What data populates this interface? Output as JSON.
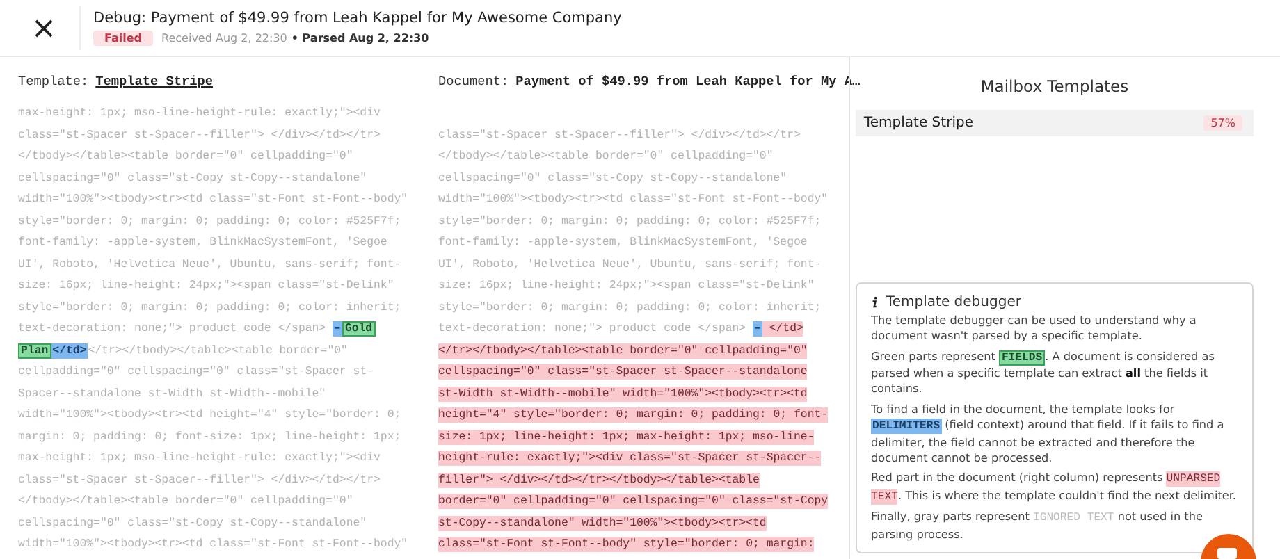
{
  "header": {
    "title": "Debug: Payment of $49.99 from Leah Kappel for My Awesome Company",
    "status": {
      "kind": "failed",
      "label": "Failed"
    },
    "received": "Received Aug 2, 22:30",
    "parsed": "• Parsed Aug 2, 22:30"
  },
  "template_pane": {
    "label": "Template:",
    "name": "Template Stripe",
    "lines": [
      [
        {
          "kind": "ignored",
          "text": "max-height: 1px; mso-line-height-rule: exactly;\"><div"
        }
      ],
      [
        {
          "kind": "ignored",
          "text": "class=\"st-Spacer st-Spacer--filler\"> </div></td></tr>"
        }
      ],
      [
        {
          "kind": "ignored",
          "text": "</tbody></table><table border=\"0\" cellpadding=\"0\""
        }
      ],
      [
        {
          "kind": "ignored",
          "text": "cellspacing=\"0\" class=\"st-Copy st-Copy--standalone\""
        }
      ],
      [
        {
          "kind": "ignored",
          "text": "width=\"100%\"><tbody><tr><td class=\"st-Font st-Font--body\""
        }
      ],
      [
        {
          "kind": "ignored",
          "text": "style=\"border: 0; margin: 0; padding: 0; color: #525F7f;"
        }
      ],
      [
        {
          "kind": "ignored",
          "text": "font-family: -apple-system, BlinkMacSystemFont, 'Segoe"
        }
      ],
      [
        {
          "kind": "ignored",
          "text": "UI', Roboto, 'Helvetica Neue', Ubuntu, sans-serif; font-"
        }
      ],
      [
        {
          "kind": "ignored",
          "text": "size: 16px; line-height: 24px;\"><span class=\"st-Delink\""
        }
      ],
      [
        {
          "kind": "ignored",
          "text": "style=\"border: 0; margin: 0; padding: 0; color: inherit;"
        }
      ],
      [
        {
          "kind": "ignored",
          "text": "text-decoration: none;\"> product_code </span> "
        },
        {
          "kind": "delimiter",
          "text": "–"
        },
        {
          "kind": "field",
          "text": "Gold"
        }
      ],
      [
        {
          "kind": "field",
          "text": "Plan"
        },
        {
          "kind": "delimiter",
          "text": "</td>"
        },
        {
          "kind": "ignored",
          "text": "</tr></tbody></table><table border=\"0\""
        }
      ],
      [
        {
          "kind": "ignored",
          "text": "cellpadding=\"0\" cellspacing=\"0\" class=\"st-Spacer st-"
        }
      ],
      [
        {
          "kind": "ignored",
          "text": "Spacer--standalone st-Width st-Width--mobile\""
        }
      ],
      [
        {
          "kind": "ignored",
          "text": "width=\"100%\"><tbody><tr><td height=\"4\" style=\"border: 0;"
        }
      ],
      [
        {
          "kind": "ignored",
          "text": "margin: 0; padding: 0; font-size: 1px; line-height: 1px;"
        }
      ],
      [
        {
          "kind": "ignored",
          "text": "max-height: 1px; mso-line-height-rule: exactly;\"><div"
        }
      ],
      [
        {
          "kind": "ignored",
          "text": "class=\"st-Spacer st-Spacer--filler\"> </div></td></tr>"
        }
      ],
      [
        {
          "kind": "ignored",
          "text": "</tbody></table><table border=\"0\" cellpadding=\"0\""
        }
      ],
      [
        {
          "kind": "ignored",
          "text": "cellspacing=\"0\" class=\"st-Copy st-Copy--standalone\""
        }
      ],
      [
        {
          "kind": "ignored",
          "text": "width=\"100%\"><tbody><tr><td class=\"st-Font st-Font--body\""
        }
      ]
    ]
  },
  "document_pane": {
    "label": "Document:",
    "name": "Payment of $49.99 from Leah Kappel for My A…",
    "lines": [
      [
        {
          "kind": "ignored",
          "text": "class=\"st-Spacer st-Spacer--filler\"> </div></td></tr>"
        }
      ],
      [
        {
          "kind": "ignored",
          "text": "</tbody></table><table border=\"0\" cellpadding=\"0\""
        }
      ],
      [
        {
          "kind": "ignored",
          "text": "cellspacing=\"0\" class=\"st-Copy st-Copy--standalone\""
        }
      ],
      [
        {
          "kind": "ignored",
          "text": "width=\"100%\"><tbody><tr><td class=\"st-Font st-Font--body\""
        }
      ],
      [
        {
          "kind": "ignored",
          "text": "style=\"border: 0; margin: 0; padding: 0; color: #525F7f;"
        }
      ],
      [
        {
          "kind": "ignored",
          "text": "font-family: -apple-system, BlinkMacSystemFont, 'Segoe"
        }
      ],
      [
        {
          "kind": "ignored",
          "text": "UI', Roboto, 'Helvetica Neue', Ubuntu, sans-serif; font-"
        }
      ],
      [
        {
          "kind": "ignored",
          "text": "size: 16px; line-height: 24px;\"><span class=\"st-Delink\""
        }
      ],
      [
        {
          "kind": "ignored",
          "text": "style=\"border: 0; margin: 0; padding: 0; color: inherit;"
        }
      ],
      [
        {
          "kind": "ignored",
          "text": "text-decoration: none;\"> product_code </span> "
        },
        {
          "kind": "delimiter",
          "text": "–"
        },
        {
          "kind": "unparsed",
          "text": " </td>"
        }
      ],
      [
        {
          "kind": "unparsed",
          "text": "</tr></tbody></table><table border=\"0\" cellpadding=\"0\""
        }
      ],
      [
        {
          "kind": "unparsed",
          "text": "cellspacing=\"0\" class=\"st-Spacer st-Spacer--standalone"
        }
      ],
      [
        {
          "kind": "unparsed",
          "text": "st-Width st-Width--mobile\" width=\"100%\"><tbody><tr><td"
        }
      ],
      [
        {
          "kind": "unparsed",
          "text": "height=\"4\" style=\"border: 0; margin: 0; padding: 0; font-"
        }
      ],
      [
        {
          "kind": "unparsed",
          "text": "size: 1px; line-height: 1px; max-height: 1px; mso-line-"
        }
      ],
      [
        {
          "kind": "unparsed",
          "text": "height-rule: exactly;\"><div class=\"st-Spacer st-Spacer--"
        }
      ],
      [
        {
          "kind": "unparsed",
          "text": "filler\"> </div></td></tr></tbody></table><table"
        }
      ],
      [
        {
          "kind": "unparsed",
          "text": "border=\"0\" cellpadding=\"0\" cellspacing=\"0\" class=\"st-Copy"
        }
      ],
      [
        {
          "kind": "unparsed",
          "text": "st-Copy--standalone\" width=\"100%\"><tbody><tr><td"
        }
      ],
      [
        {
          "kind": "unparsed",
          "text": "class=\"st-Font st-Font--body\" style=\"border: 0; margin:"
        }
      ]
    ]
  },
  "mailbox_templates": {
    "title": "Mailbox Templates",
    "items": [
      {
        "name": "Template Stripe",
        "match": "57%",
        "selected": true
      }
    ]
  },
  "debugger": {
    "title": "Template debugger",
    "paragraphs": [
      [
        {
          "kind": "text",
          "text": "The template debugger can be used to understand why a document wasn't parsed by a specific template."
        }
      ],
      [
        {
          "kind": "text",
          "text": "Green parts represent "
        },
        {
          "kind": "field",
          "text": "FIELDS"
        },
        {
          "kind": "text",
          "text": ". A document is considered as parsed when a specific template can extract "
        },
        {
          "kind": "bold",
          "text": "all"
        },
        {
          "kind": "text",
          "text": " the fields it contains."
        }
      ],
      [
        {
          "kind": "text",
          "text": "To find a field in the document, the template looks for "
        },
        {
          "kind": "delimiter",
          "text": "DELIMITERS"
        },
        {
          "kind": "text",
          "text": " (field context) around that field. If it fails to find a delimiter, the field cannot be extracted and therefore the document cannot be processed."
        }
      ],
      [
        {
          "kind": "text",
          "text": "Red part in the document (right column) represents "
        },
        {
          "kind": "unparsed",
          "text": "UNPARSED TEXT"
        },
        {
          "kind": "text",
          "text": ". This is where the template couldn't find the next delimiter."
        }
      ],
      [
        {
          "kind": "text",
          "text": "Finally, gray parts represent "
        },
        {
          "kind": "ignored",
          "text": "IGNORED TEXT"
        },
        {
          "kind": "text",
          "text": " not used in the parsing process."
        }
      ]
    ]
  }
}
